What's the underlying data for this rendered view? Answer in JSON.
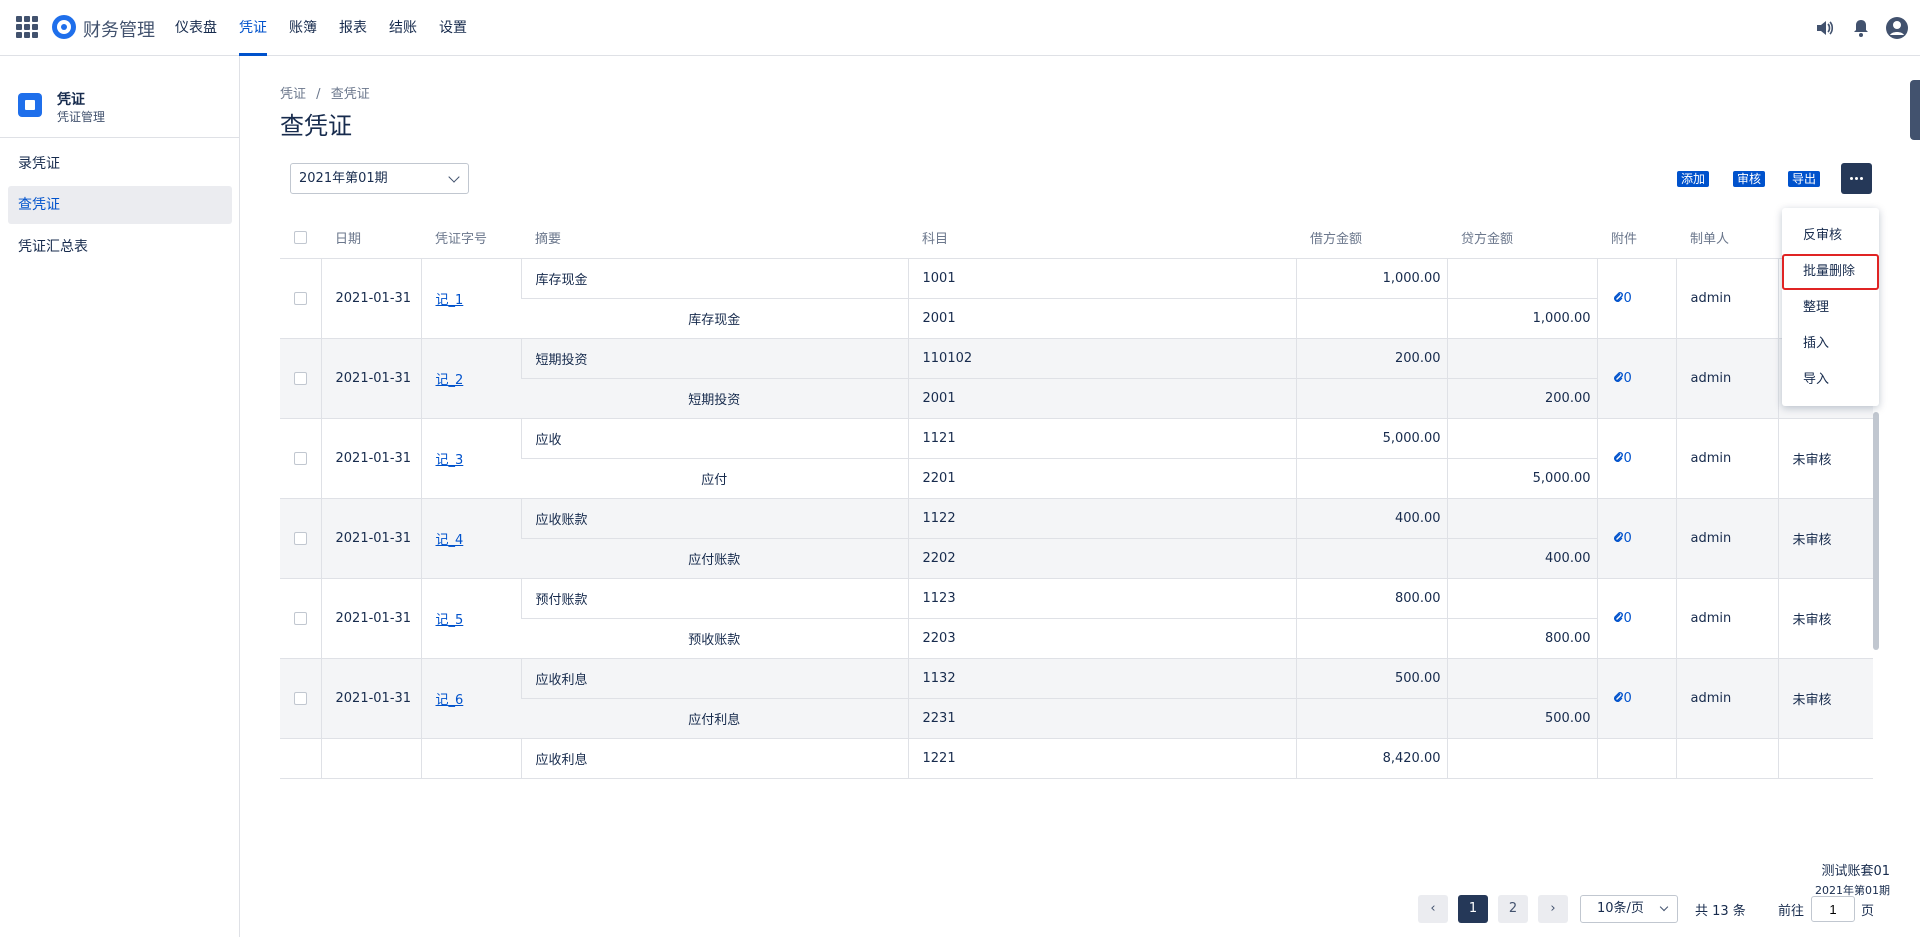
{
  "app": {
    "name": "财务管理"
  },
  "nav": [
    "仪表盘",
    "凭证",
    "账簿",
    "报表",
    "结账",
    "设置"
  ],
  "sidebar": {
    "title": "凭证",
    "subtitle": "凭证管理",
    "items": [
      "录凭证",
      "查凭证",
      "凭证汇总表"
    ]
  },
  "breadcrumb": [
    "凭证",
    "/",
    "查凭证"
  ],
  "page_title": "查凭证",
  "period": "2021年第01期",
  "toolbar": {
    "add": "添加",
    "audit": "审核",
    "export": "导出"
  },
  "dropdown": [
    "反审核",
    "批量删除",
    "整理",
    "插入",
    "导入"
  ],
  "table": {
    "headers": [
      "日期",
      "凭证字号",
      "摘要",
      "科目",
      "借方金额",
      "贷方金额",
      "附件",
      "制单人",
      ""
    ],
    "rows": [
      {
        "date": "2021-01-31",
        "no": "记_1",
        "attach": "0",
        "maker": "admin",
        "status": "",
        "lines": [
          {
            "summary": "库存现金",
            "account": "1001",
            "debit": "1,000.00",
            "credit": ""
          },
          {
            "summary": "库存现金",
            "account": "2001",
            "debit": "",
            "credit": "1,000.00"
          }
        ]
      },
      {
        "date": "2021-01-31",
        "no": "记_2",
        "attach": "0",
        "maker": "admin",
        "status": "",
        "lines": [
          {
            "summary": "短期投资",
            "account": "110102",
            "debit": "200.00",
            "credit": ""
          },
          {
            "summary": "短期投资",
            "account": "2001",
            "debit": "",
            "credit": "200.00"
          }
        ]
      },
      {
        "date": "2021-01-31",
        "no": "记_3",
        "attach": "0",
        "maker": "admin",
        "status": "未审核",
        "lines": [
          {
            "summary": "应收",
            "account": "1121",
            "debit": "5,000.00",
            "credit": ""
          },
          {
            "summary": "应付",
            "account": "2201",
            "debit": "",
            "credit": "5,000.00"
          }
        ]
      },
      {
        "date": "2021-01-31",
        "no": "记_4",
        "attach": "0",
        "maker": "admin",
        "status": "未审核",
        "lines": [
          {
            "summary": "应收账款",
            "account": "1122",
            "debit": "400.00",
            "credit": ""
          },
          {
            "summary": "应付账款",
            "account": "2202",
            "debit": "",
            "credit": "400.00"
          }
        ]
      },
      {
        "date": "2021-01-31",
        "no": "记_5",
        "attach": "0",
        "maker": "admin",
        "status": "未审核",
        "lines": [
          {
            "summary": "预付账款",
            "account": "1123",
            "debit": "800.00",
            "credit": ""
          },
          {
            "summary": "预收账款",
            "account": "2203",
            "debit": "",
            "credit": "800.00"
          }
        ]
      },
      {
        "date": "2021-01-31",
        "no": "记_6",
        "attach": "0",
        "maker": "admin",
        "status": "未审核",
        "lines": [
          {
            "summary": "应收利息",
            "account": "1132",
            "debit": "500.00",
            "credit": ""
          },
          {
            "summary": "应付利息",
            "account": "2231",
            "debit": "",
            "credit": "500.00"
          }
        ]
      },
      {
        "date": "",
        "no": "",
        "attach": "",
        "maker": "",
        "status": "",
        "lines": [
          {
            "summary": "应收利息",
            "account": "1221",
            "debit": "8,420.00",
            "credit": ""
          }
        ]
      }
    ]
  },
  "pagination": {
    "pages": [
      "1",
      "2"
    ],
    "page_size": "10条/页",
    "total": "共 13 条",
    "goto_label": "前往",
    "goto_value": "1",
    "page_unit": "页"
  },
  "corner": {
    "book": "测试账套01",
    "period": "2021年第01期"
  }
}
